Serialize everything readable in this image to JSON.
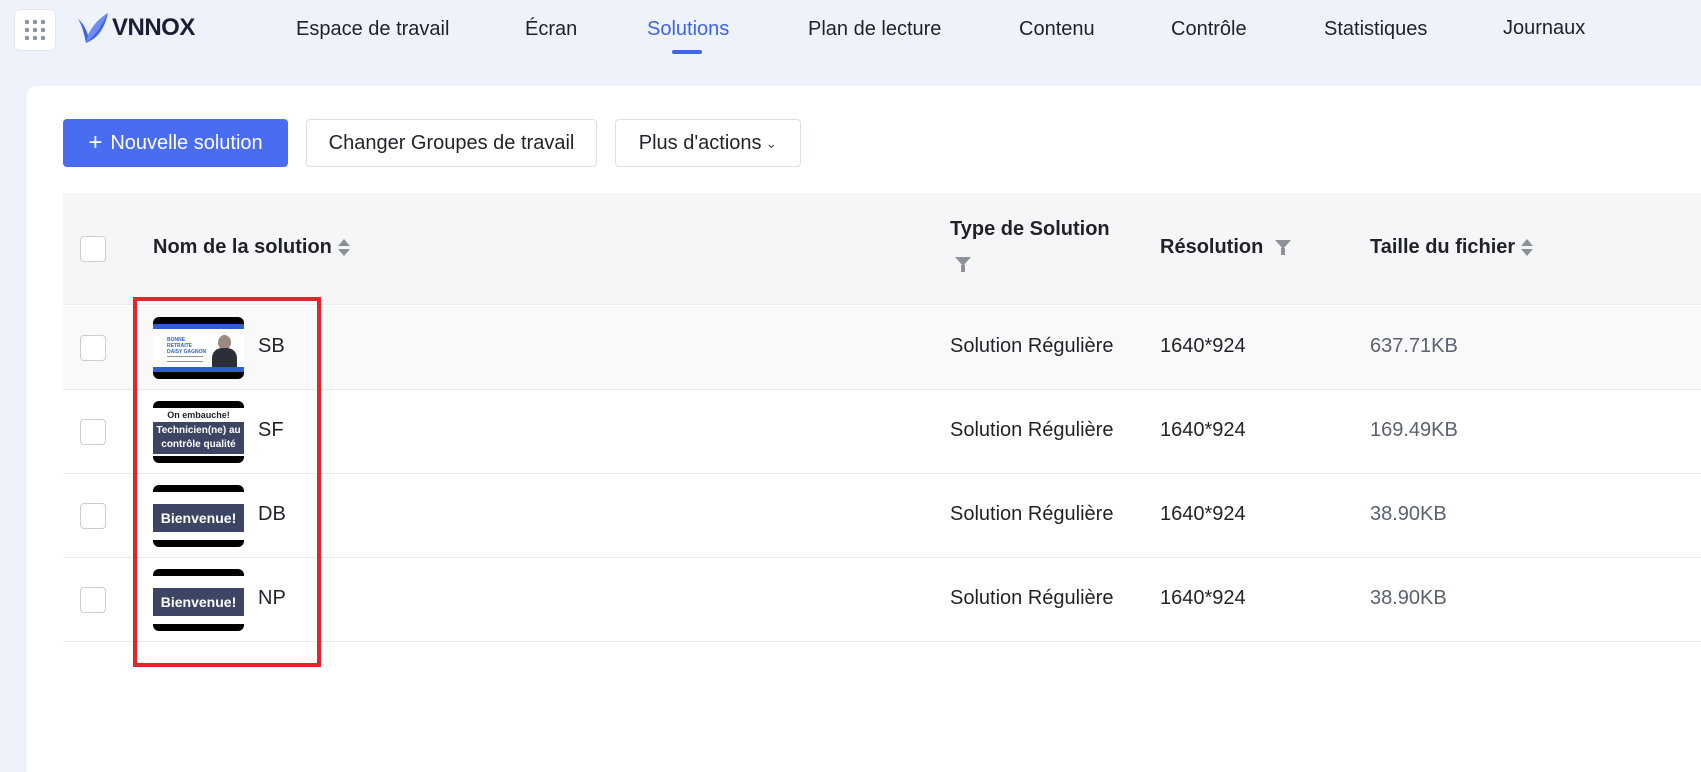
{
  "header": {
    "logo_text": "VNNOX",
    "nav": [
      {
        "label": "Espace de travail"
      },
      {
        "label": "Écran"
      },
      {
        "label": "Solutions",
        "active": true
      },
      {
        "label": "Plan de lecture"
      },
      {
        "label": "Contenu"
      },
      {
        "label": "Contrôle"
      },
      {
        "label": "Statistiques"
      },
      {
        "label": "Journaux"
      }
    ]
  },
  "toolbar": {
    "new_solution_label": "Nouvelle solution",
    "change_workgroup_label": "Changer Groupes de travail",
    "more_actions_label": "Plus d'actions"
  },
  "table": {
    "columns": {
      "name": "Nom de la solution",
      "type": "Type de Solution",
      "resolution": "Résolution",
      "file_size": "Taille du fichier"
    },
    "rows": [
      {
        "name": "SB",
        "type": "Solution Régulière",
        "resolution": "1640*924",
        "file_size": "637.71KB",
        "thumb": "sb"
      },
      {
        "name": "SF",
        "type": "Solution Régulière",
        "resolution": "1640*924",
        "file_size": "169.49KB",
        "thumb": "sf"
      },
      {
        "name": "DB",
        "type": "Solution Régulière",
        "resolution": "1640*924",
        "file_size": "38.90KB",
        "thumb": "welcome"
      },
      {
        "name": "NP",
        "type": "Solution Régulière",
        "resolution": "1640*924",
        "file_size": "38.90KB",
        "thumb": "welcome"
      }
    ]
  },
  "thumbnails": {
    "sb": {
      "text": "BONNE RETRAITE DAISY GAGNON"
    },
    "sf": {
      "top": "On embauche!",
      "box": "Technicien(ne) au contrôle qualité"
    },
    "welcome": {
      "text": "Bienvenue!"
    }
  },
  "colors": {
    "accent": "#3e64e8",
    "primary_button": "#4a6cf0",
    "highlight": "#e3242b",
    "thumb_box": "#3c4664"
  }
}
